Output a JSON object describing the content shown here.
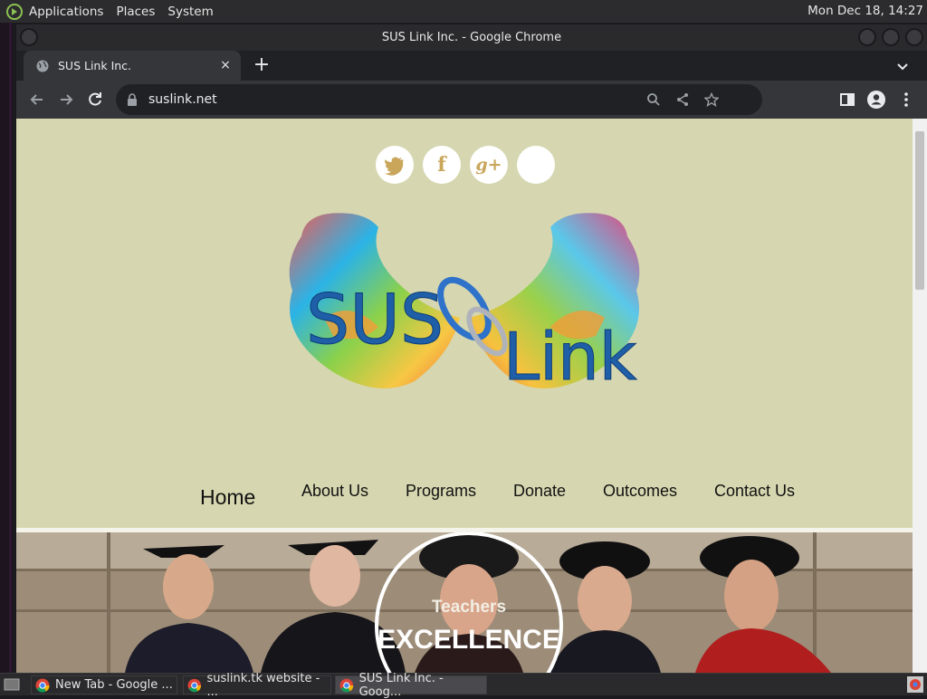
{
  "desktop": {
    "menus": [
      "Applications",
      "Places",
      "System"
    ],
    "clock": "Mon Dec 18, 14:27"
  },
  "window": {
    "title": "SUS Link Inc. - Google Chrome"
  },
  "tab": {
    "title": "SUS Link Inc.",
    "close_glyph": "×",
    "new_tab_glyph": "+"
  },
  "omnibox": {
    "url": "suslink.net"
  },
  "site": {
    "social_glyphs": [
      "f",
      "g+"
    ],
    "logo_text_left": "SUS",
    "logo_text_right": "Link",
    "nav": [
      "Home",
      "About Us",
      "Programs",
      "Donate",
      "Outcomes",
      "Contact Us"
    ],
    "hero_small": "Teachers",
    "hero_big": "EXCELLENCE"
  },
  "taskbar": {
    "items": [
      "New Tab - Google ...",
      "suslink.tk website - ...",
      "SUS Link Inc. - Goog..."
    ]
  },
  "colors": {
    "page_bg": "#d6d7b0",
    "social_icon": "#c9a65a",
    "logo_blue": "#1f5fa8"
  }
}
